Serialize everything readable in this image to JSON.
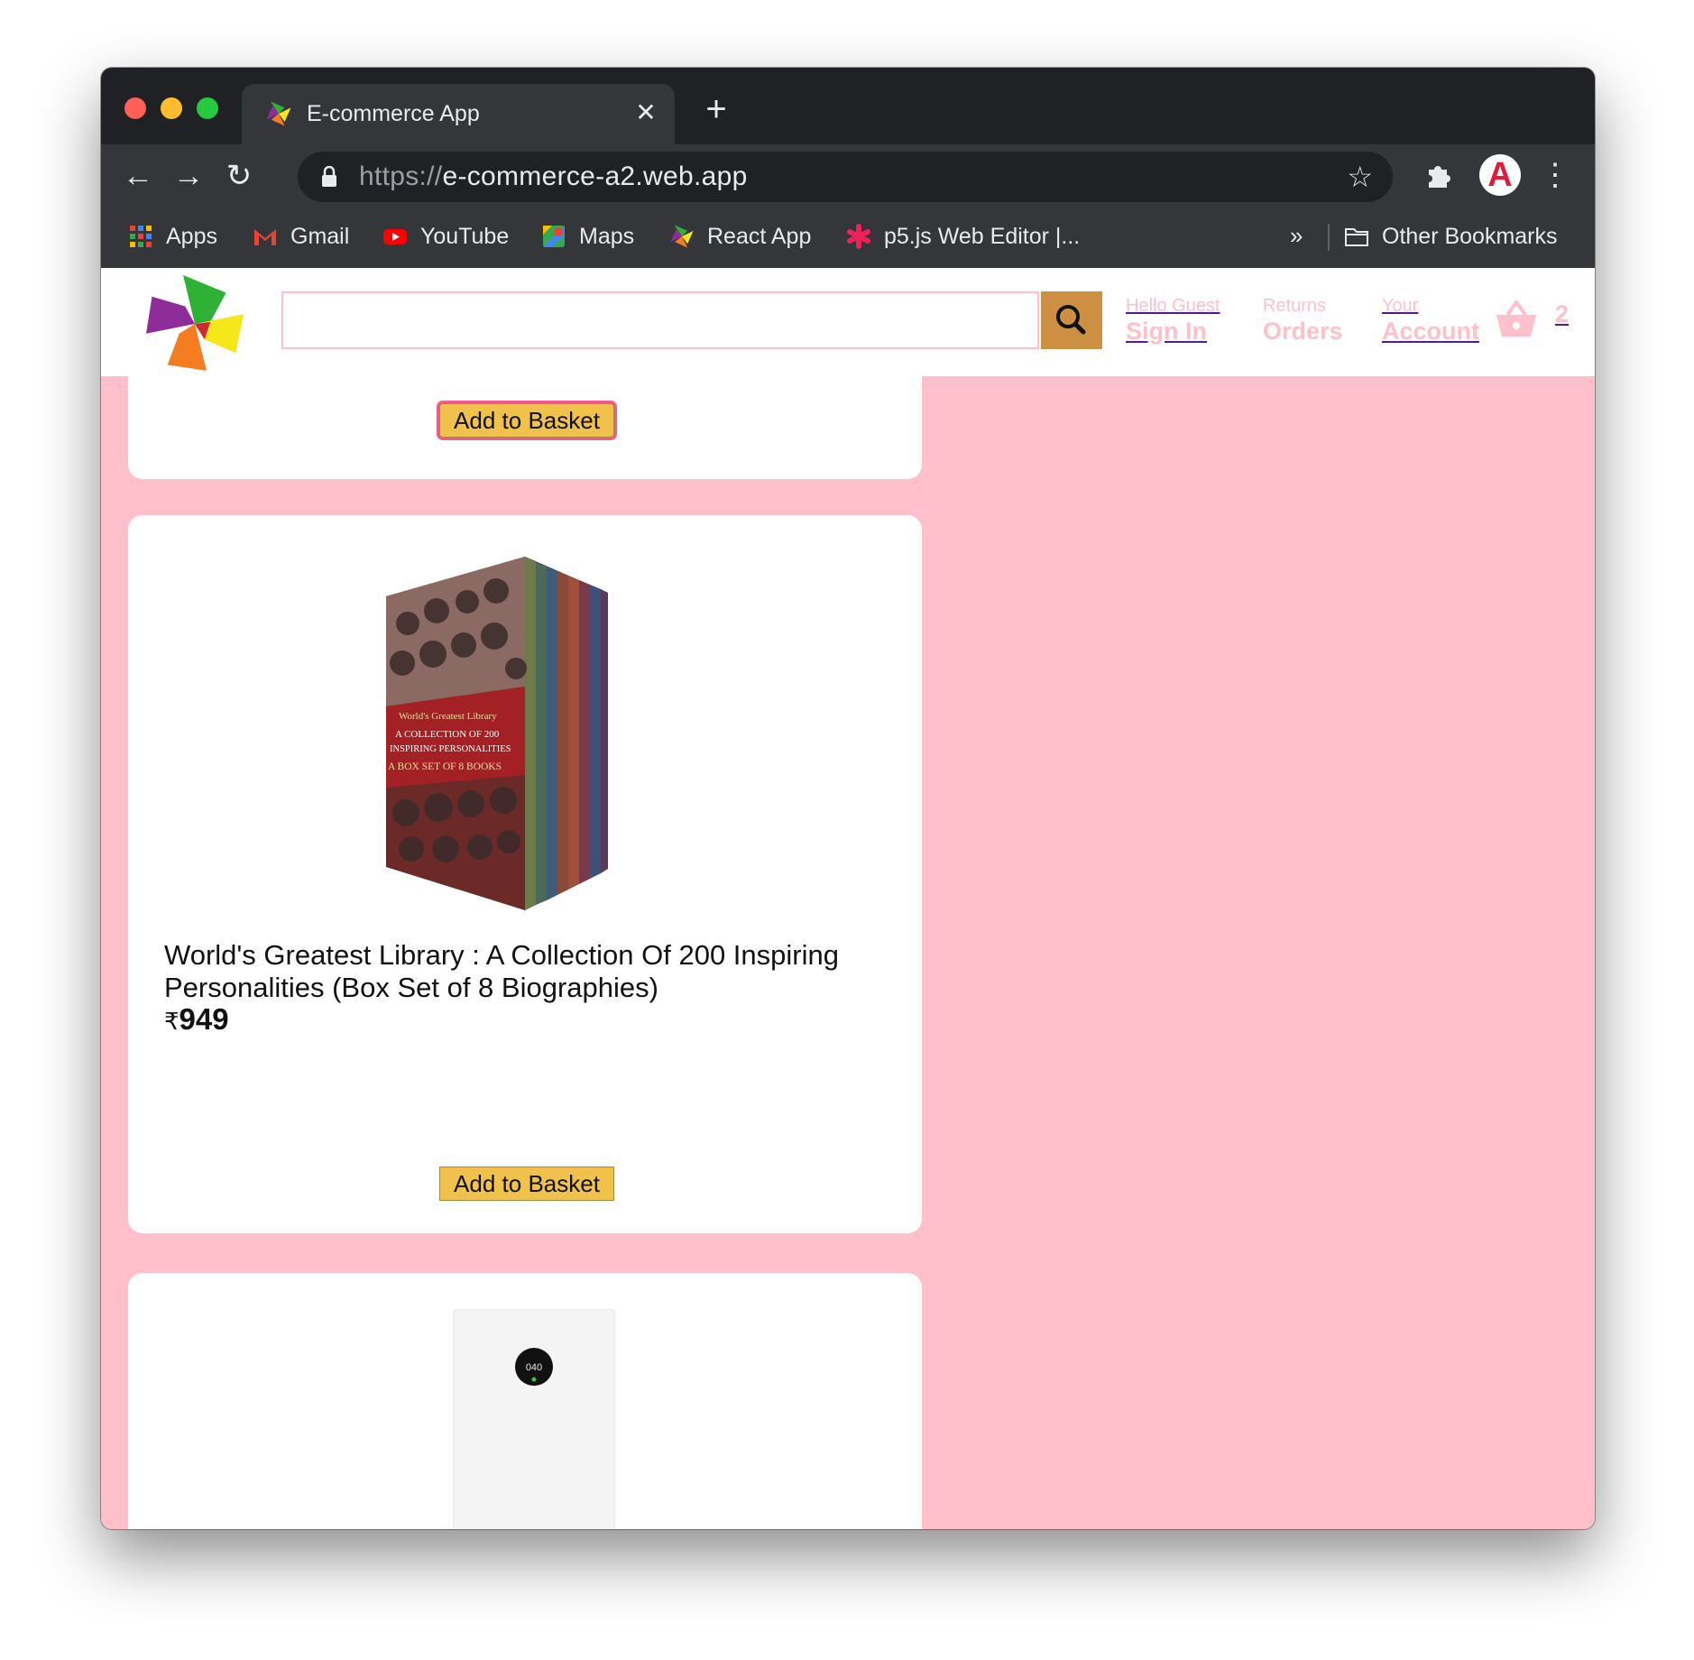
{
  "browser": {
    "tab_title": "E-commerce App",
    "url_scheme": "https://",
    "url_rest": "e-commerce-a2.web.app",
    "bookmarks": [
      {
        "label": "Apps",
        "icon": "apps-grid-icon"
      },
      {
        "label": "Gmail",
        "icon": "gmail-icon"
      },
      {
        "label": "YouTube",
        "icon": "youtube-icon"
      },
      {
        "label": "Maps",
        "icon": "maps-icon"
      },
      {
        "label": "React App",
        "icon": "pinwheel-icon"
      },
      {
        "label": "p5.js Web Editor |...",
        "icon": "p5-asterisk-icon"
      }
    ],
    "more_bookmarks": "»",
    "other_bookmarks": "Other Bookmarks",
    "profile_letter": "A"
  },
  "header": {
    "search_value": "",
    "nav": [
      {
        "line1": "Hello Guest",
        "line2": "Sign In"
      },
      {
        "line1": "Returns",
        "line2": "Orders"
      },
      {
        "line1": "Your",
        "line2": "Account"
      }
    ],
    "basket_count": "2"
  },
  "products": [
    {
      "add_label": "Add to Basket"
    },
    {
      "title": "World's Greatest Library : A Collection Of 200 Inspiring Personalities (Box Set of 8 Biographies)",
      "currency": "₹",
      "price": "949",
      "add_label": "Add to Basket",
      "cover_text": {
        "series": "World's Greatest Library",
        "line1": "A COLLECTION OF 200",
        "line2": "INSPIRING PERSONALITIES",
        "line3": "A BOX SET OF 8 BOOKS"
      }
    },
    {
      "image_readout": "040"
    }
  ],
  "colors": {
    "page_bg": "#ffc0cb",
    "search_button": "#cd9042",
    "add_button": "#f0c14b",
    "browser_dark": "#202124",
    "browser_toolbar": "#35363a"
  }
}
